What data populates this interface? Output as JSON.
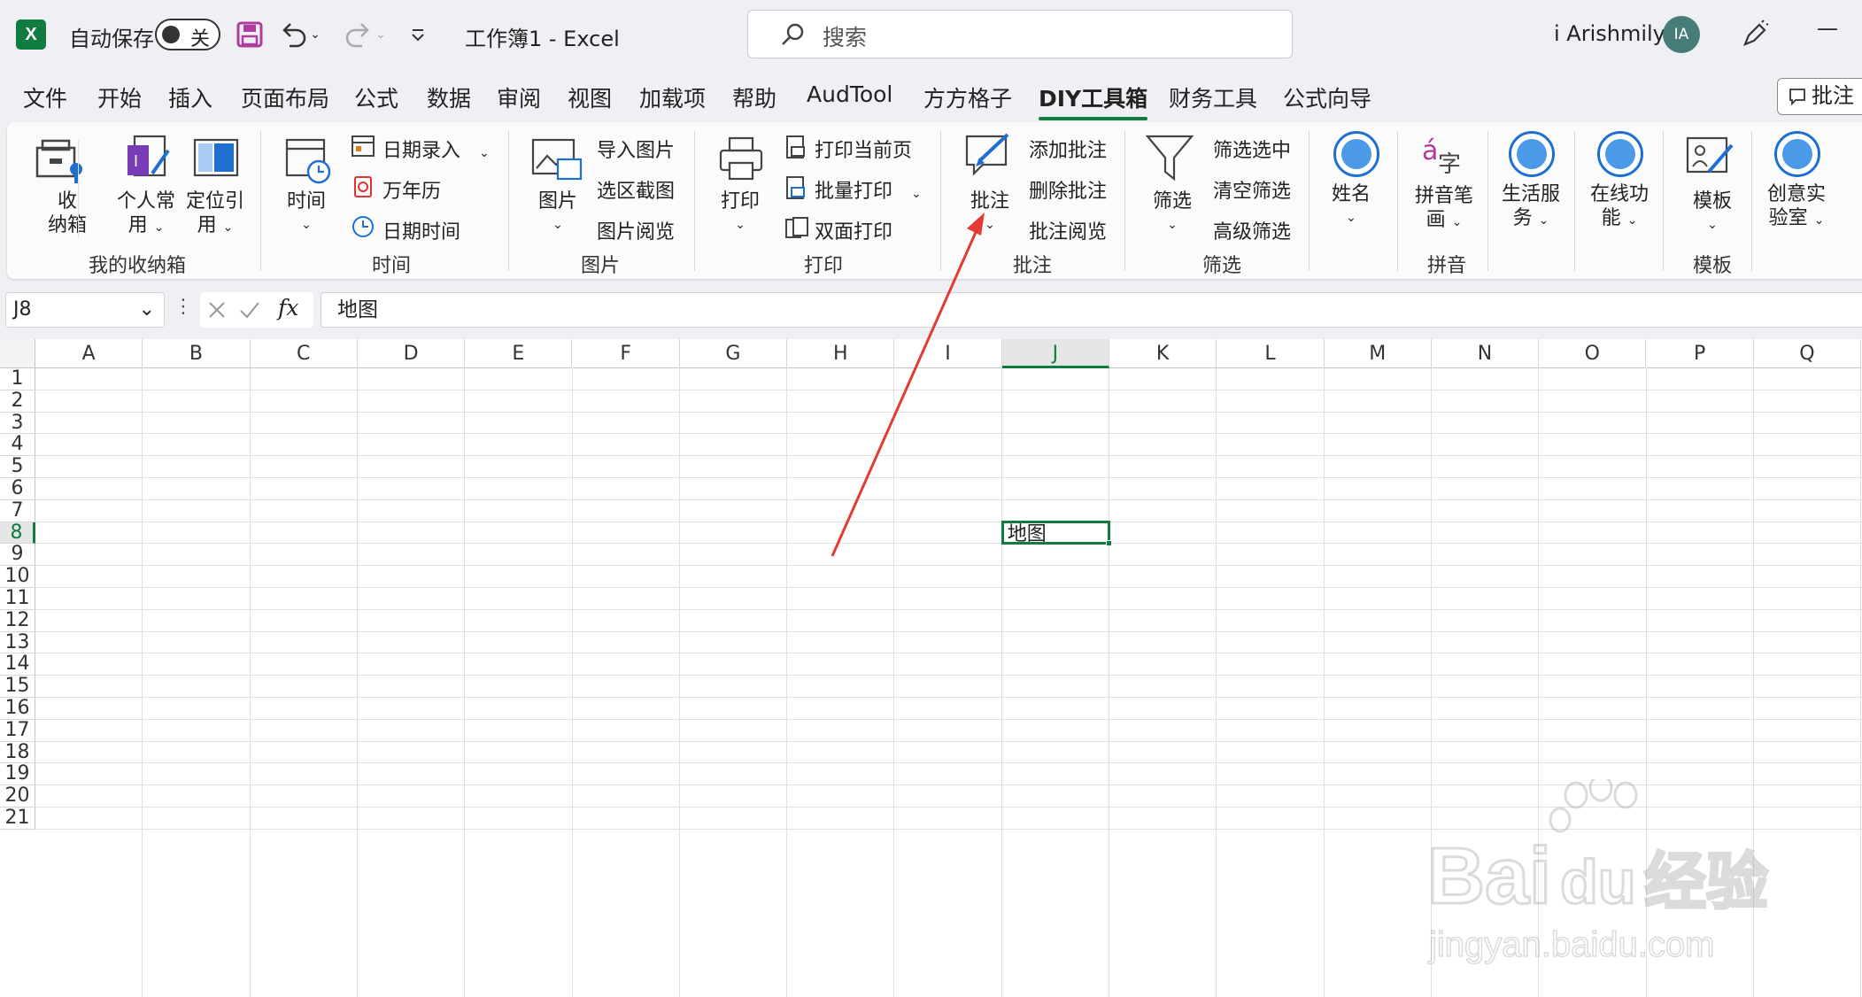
{
  "titlebar": {
    "autosave_label": "自动保存",
    "autosave_state": "关",
    "document_title": "工作簿1  -  Excel",
    "search_placeholder": "搜索",
    "user_name": "i Arishmily",
    "avatar_initials": "IA",
    "minimize": "—"
  },
  "menu": {
    "tabs": [
      "文件",
      "开始",
      "插入",
      "页面布局",
      "公式",
      "数据",
      "审阅",
      "视图",
      "加载项",
      "帮助",
      "AudTool",
      "方方格子",
      "DIY工具箱",
      "财务工具",
      "公式向导"
    ],
    "active_tab": "DIY工具箱",
    "comment_button": "批注"
  },
  "ribbon": {
    "groups": {
      "shounaxiang": {
        "label": "我的收纳箱",
        "b1_line1": "收",
        "b1_line2": "纳箱",
        "b2_line1": "个人常",
        "b2_line2": "用",
        "b3_line1": "定位引",
        "b3_line2": "用"
      },
      "time": {
        "label": "时间",
        "big": "时间",
        "items": [
          "日期录入",
          "万年历",
          "日期时间"
        ]
      },
      "picture": {
        "label": "图片",
        "big": "图片",
        "items": [
          "导入图片",
          "选区截图",
          "图片阅览"
        ]
      },
      "print": {
        "label": "打印",
        "big": "打印",
        "items": [
          "打印当前页",
          "批量打印",
          "双面打印"
        ]
      },
      "comment": {
        "label": "批注",
        "big": "批注",
        "items": [
          "添加批注",
          "删除批注",
          "批注阅览"
        ]
      },
      "filter": {
        "label": "筛选",
        "big": "筛选",
        "items": [
          "筛选选中",
          "清空筛选",
          "高级筛选"
        ]
      },
      "name": {
        "big": "姓名"
      },
      "pinyin": {
        "label": "拼音",
        "big_line1": "拼音笔",
        "big_line2": "画"
      },
      "life": {
        "big_line1": "生活服",
        "big_line2": "务"
      },
      "online": {
        "big_line1": "在线功",
        "big_line2": "能"
      },
      "template": {
        "label": "模板",
        "big": "模板"
      },
      "lab": {
        "big_line1": "创意实",
        "big_line2": "验室"
      }
    }
  },
  "formula_bar": {
    "name_box": "J8",
    "fx": "fx",
    "content": "地图"
  },
  "sheet": {
    "columns": [
      "A",
      "B",
      "C",
      "D",
      "E",
      "F",
      "G",
      "H",
      "I",
      "J",
      "K",
      "L",
      "M",
      "N",
      "O",
      "P",
      "Q"
    ],
    "rows": [
      "1",
      "2",
      "3",
      "4",
      "5",
      "6",
      "7",
      "8",
      "9",
      "10",
      "11",
      "12",
      "13",
      "14",
      "15",
      "16",
      "17",
      "18",
      "19",
      "20",
      "21"
    ],
    "selected_column": "J",
    "selected_row": "8",
    "active_cell_value": "地图"
  },
  "colors": {
    "excel_green": "#107c41",
    "annotation_arrow": "#e53935"
  },
  "watermark": {
    "brand": "Bai du 经验",
    "url": "jingyan.baidu.com"
  }
}
